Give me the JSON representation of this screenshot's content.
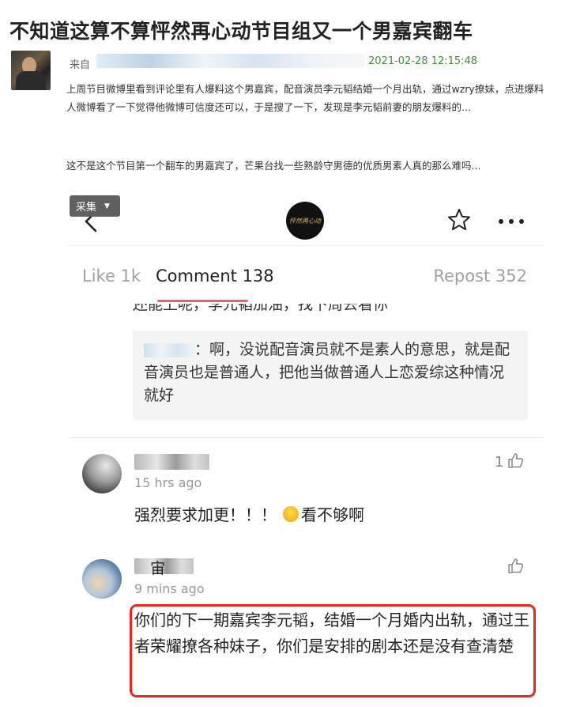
{
  "post": {
    "title": "不知道这算不算怦然再心动节目组又一个男嘉宾翻车",
    "source_label": "来自",
    "time": "2021-02-28 12:15:48",
    "paragraph_1": "上周节目微博里看到评论里有人爆料这个男嘉宾，配音演员李元韬结婚一个月出轨，通过wzry撩妹，点进爆料人微博看了一下觉得他微博可信度还可以，于是搜了一下，发现是李元韬前妻的朋友爆料的...",
    "paragraph_2": "这不是这个节目第一个翻车的男嘉宾了，芒果台找一些熟龄守男德的优质男素人真的那么难吗..."
  },
  "screenshot": {
    "collect_label": "采集",
    "logo_text": "怦然再心动",
    "tabs": {
      "like": "Like 1k",
      "comment": "Comment 138",
      "repost": "Repost 352"
    },
    "cut_line": "还能上呢，李元韬加油，找下周去看你",
    "reply_text": "：啊，没说配音演员就不是素人的意思，就是配音演员也是普通人，把他当做普通人上恋爱综这种情况就好",
    "comments": [
      {
        "time": "15 hrs ago",
        "likes": "1",
        "text": "强烈要求加更！！！",
        "text_after_emoji": "看不够啊"
      },
      {
        "name_visible": "宙",
        "time": "9 mins ago",
        "text": "你们的下一期嘉宾李元韬，结婚一个月婚内出轨，通过王者荣耀撩各种妹子，你们是安排的剧本还是没有查清楚"
      }
    ]
  },
  "colors": {
    "highlight": "#e8281f",
    "tab_underline": "#f06262",
    "time_green": "#3f8f3a"
  }
}
